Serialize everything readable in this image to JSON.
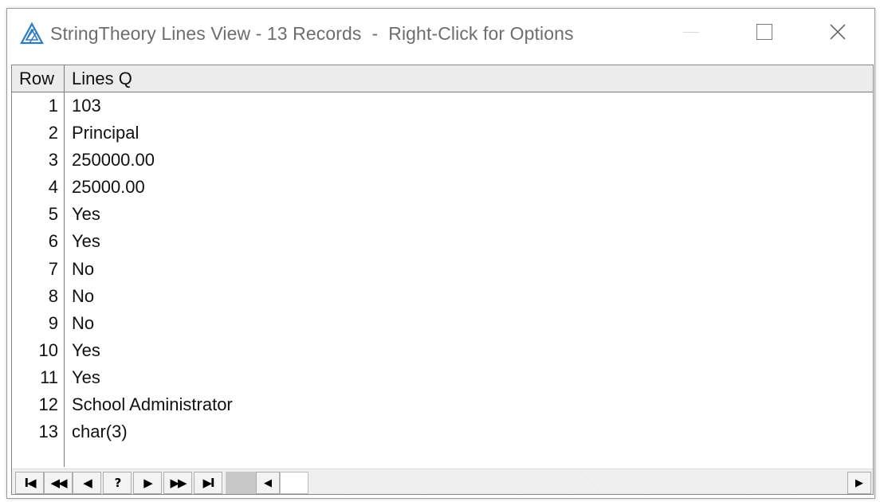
{
  "window": {
    "title": "StringTheory Lines View - 13 Records  -  Right-Click for Options",
    "app_icon": "stringtheory-triangle-icon",
    "accent_color": "#2b7bbf"
  },
  "grid": {
    "columns": [
      "Row",
      "Lines Q"
    ],
    "rows": [
      {
        "num": "1",
        "value": "103"
      },
      {
        "num": "2",
        "value": "Principal"
      },
      {
        "num": "3",
        "value": "250000.00"
      },
      {
        "num": "4",
        "value": "25000.00"
      },
      {
        "num": "5",
        "value": "Yes"
      },
      {
        "num": "6",
        "value": "Yes"
      },
      {
        "num": "7",
        "value": "No"
      },
      {
        "num": "8",
        "value": "No"
      },
      {
        "num": "9",
        "value": "No"
      },
      {
        "num": "10",
        "value": "Yes"
      },
      {
        "num": "11",
        "value": "Yes"
      },
      {
        "num": "12",
        "value": "School Administrator"
      },
      {
        "num": "13",
        "value": "char(3)"
      }
    ]
  },
  "navigation": {
    "buttons": [
      {
        "name": "first-record-button",
        "icon": "skip-to-first-icon",
        "glyph": "I◀"
      },
      {
        "name": "previous-page-button",
        "icon": "double-left-icon",
        "glyph": "◀◀"
      },
      {
        "name": "previous-record-button",
        "icon": "left-icon",
        "glyph": "◀"
      },
      {
        "name": "help-button",
        "icon": "question-icon",
        "glyph": "?"
      },
      {
        "name": "next-record-button",
        "icon": "right-icon",
        "glyph": "▶"
      },
      {
        "name": "next-page-button",
        "icon": "double-right-icon",
        "glyph": "▶▶"
      },
      {
        "name": "last-record-button",
        "icon": "skip-to-last-icon",
        "glyph": "▶I"
      }
    ],
    "scroll_left_glyph": "◀",
    "scroll_right_glyph": "▶"
  }
}
